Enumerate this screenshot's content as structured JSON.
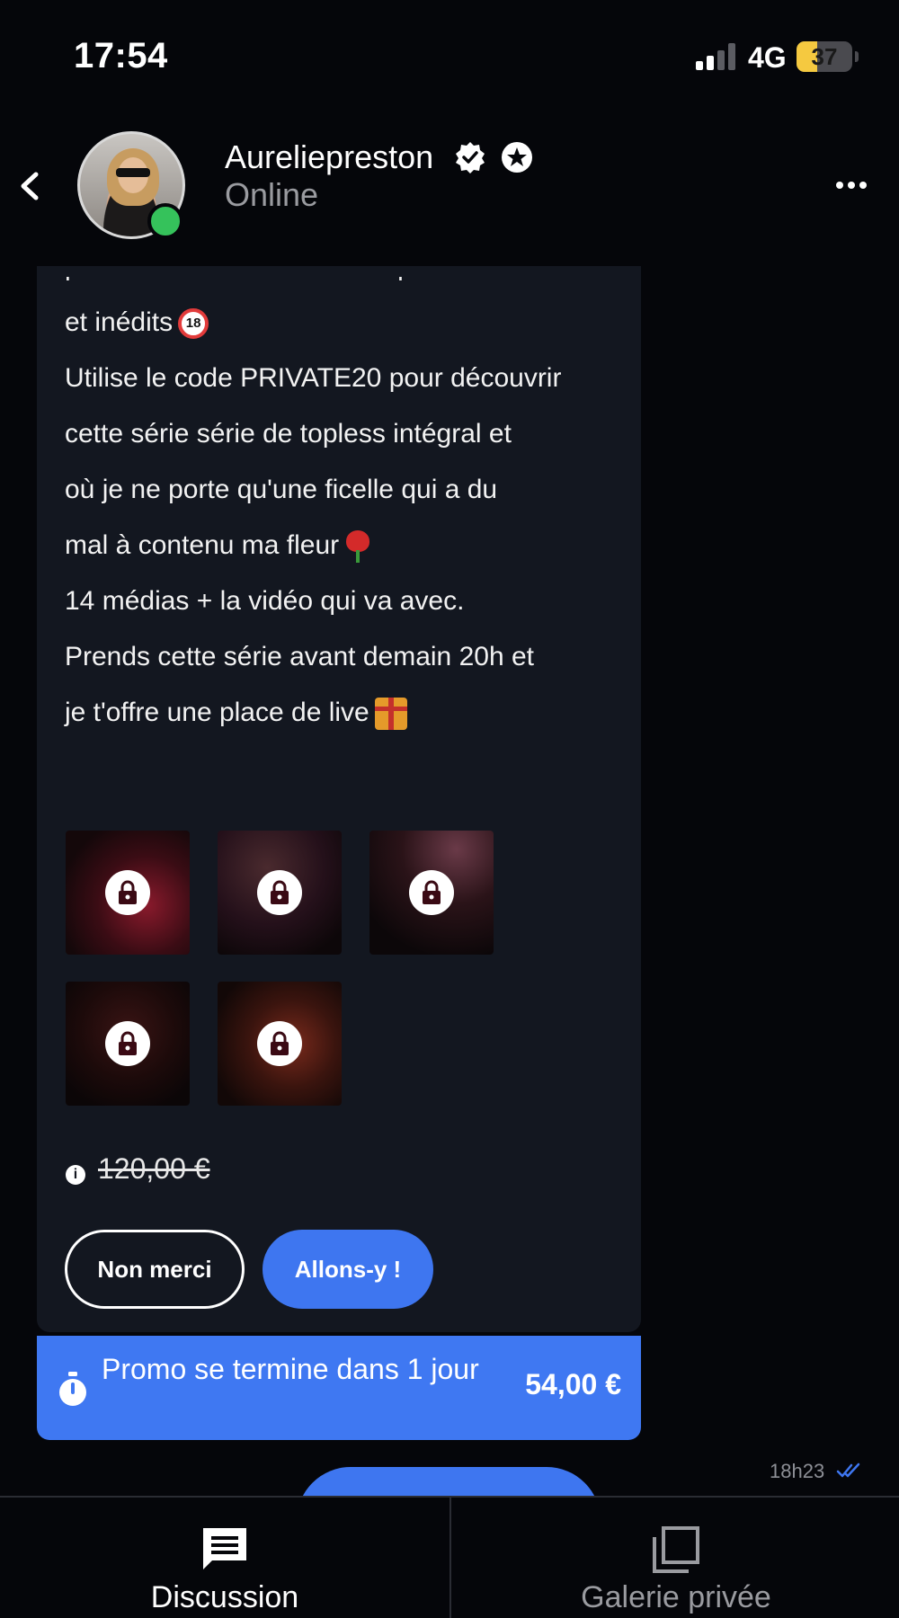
{
  "status_bar": {
    "time": "17:54",
    "network": "4G",
    "battery": "37",
    "battery_level": 0.37,
    "signal_bars": 2
  },
  "header": {
    "contact_name": "Aureliepreston",
    "status": "Online",
    "icons": [
      "back-chevron-icon",
      "verified-badge-icon",
      "star-badge-icon",
      "more-options-icon"
    ]
  },
  "message": {
    "lines": [
      "pleuvent sur les médias les plus intimes",
      "et inédits",
      "Utilise le code PRIVATE20 pour découvrir",
      "cette série série de topless intégral et",
      "où je ne porte qu'une ficelle qui a du",
      "mal à contenu ma fleur",
      "14 médias + la vidéo qui va avec.",
      "Prends cette série avant demain 20h et",
      "je t'offre une place de live"
    ],
    "emoji_18": "18",
    "locked_media_count": 5,
    "old_price": "120,00 €",
    "decline_label": "Non merci",
    "accept_label": "Allons-y !"
  },
  "promo": {
    "text": "Promo se termine dans 1 jour",
    "price": "54,00 €"
  },
  "message_time": "18h23",
  "colors": {
    "accent": "#3e76f0",
    "bubble": "#131720",
    "online": "#35c25b"
  },
  "tabs": [
    {
      "label": "Discussion",
      "icon": "chat-icon",
      "active": true
    },
    {
      "label": "Galerie privée",
      "icon": "gallery-icon",
      "active": false
    }
  ]
}
